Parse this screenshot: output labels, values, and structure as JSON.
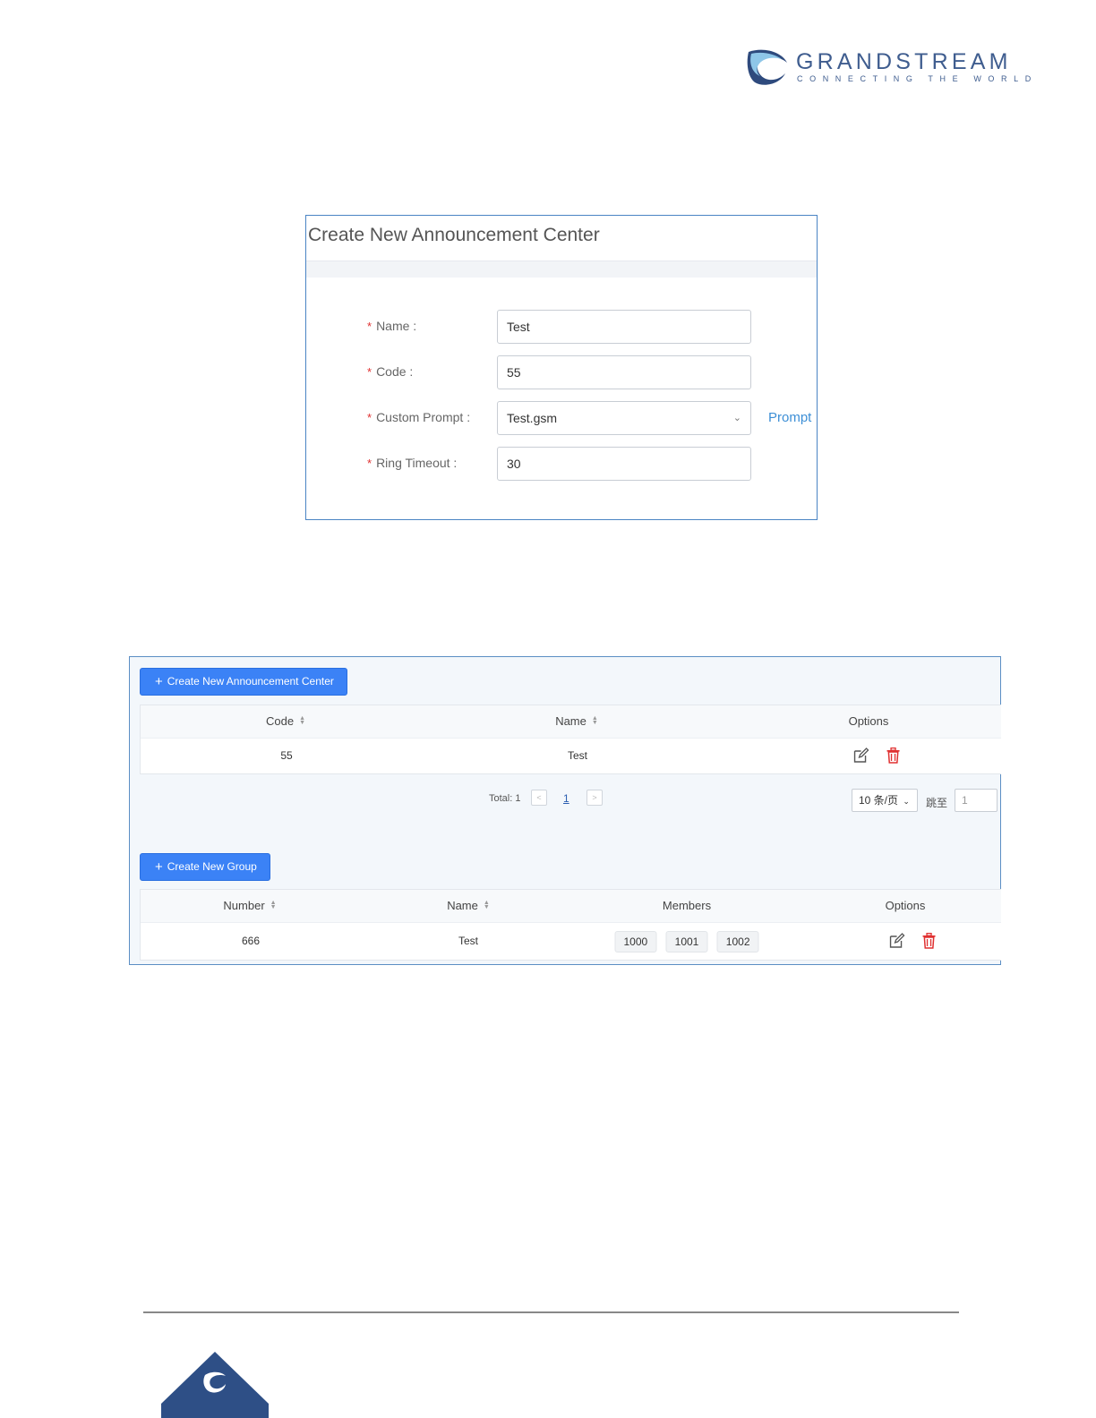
{
  "logo": {
    "brand": "GRANDSTREAM",
    "tagline": "CONNECTING THE WORLD",
    "color": "#3f5d8f"
  },
  "dialog": {
    "title": "Create New Announcement Center",
    "fields": [
      {
        "label": "Name",
        "value": "Test"
      },
      {
        "label": "Code",
        "value": "55"
      },
      {
        "label": "Custom Prompt",
        "value": "Test.gsm"
      },
      {
        "label": "Ring Timeout",
        "value": "30"
      }
    ],
    "prompt_link": "Prompt"
  },
  "announcement_panel": {
    "create_button": "Create New Announcement Center",
    "columns": [
      "Code",
      "Name",
      "Options"
    ],
    "rows": [
      {
        "code": "55",
        "name": "Test"
      }
    ],
    "pagination": {
      "total_label": "Total: 1",
      "current_page": "1",
      "page_size": "10 条/页",
      "jump_label": "跳至",
      "jump_value": "1"
    }
  },
  "group_panel": {
    "create_button": "Create New Group",
    "columns": [
      "Number",
      "Name",
      "Members",
      "Options"
    ],
    "rows": [
      {
        "number": "666",
        "name": "Test",
        "members": [
          "1000",
          "1001",
          "1002"
        ]
      }
    ]
  },
  "colors": {
    "accent": "#3b82f6",
    "required": "#e03030",
    "link": "#3d8fd6",
    "delete": "#e03030"
  }
}
